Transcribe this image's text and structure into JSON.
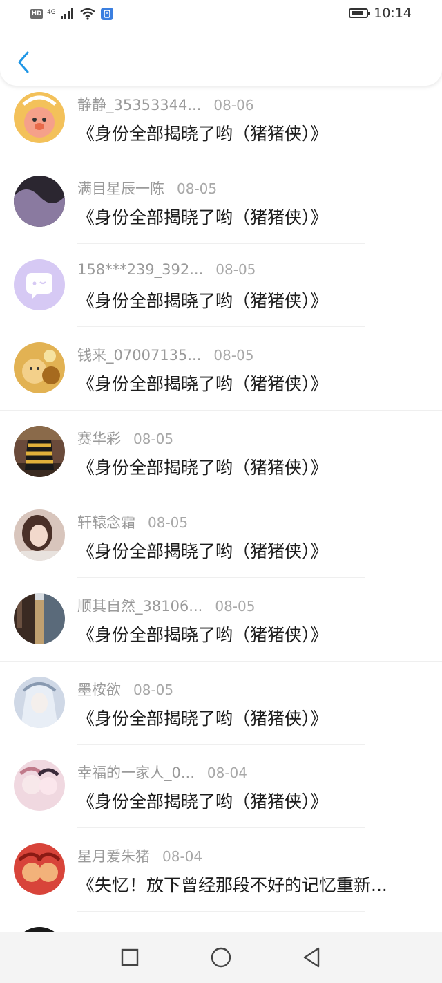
{
  "status_bar": {
    "hd": "HD",
    "network": "4G",
    "time": "10:14",
    "battery_level": 0.85
  },
  "header": {
    "back_icon": "chevron-left-icon",
    "accent_color": "#1e96e6"
  },
  "items": [
    {
      "username": "静静_35353344...",
      "date": "08-06",
      "title": "《身份全部揭晓了哟（猪猪侠）》",
      "avatar": {
        "kind": "cartoon",
        "bg": "#f3c15a",
        "fg": "#e86a4a"
      }
    },
    {
      "username": "满目星辰一陈",
      "date": "08-05",
      "title": "《身份全部揭晓了哟（猪猪侠）》",
      "avatar": {
        "kind": "dark",
        "bg": "#2b2630",
        "fg": "#8a7aa0"
      }
    },
    {
      "username": "158***239_392...",
      "date": "08-05",
      "title": "《身份全部揭晓了哟（猪猪侠）》",
      "avatar": {
        "kind": "default",
        "bg": "#d6c9f4",
        "fg": "#ffffff"
      }
    },
    {
      "username": "钱来_07007135...",
      "date": "08-05",
      "title": "《身份全部揭晓了哟（猪猪侠）》",
      "avatar": {
        "kind": "gold",
        "bg": "#e2b253",
        "fg": "#a66a1e"
      }
    },
    {
      "username": "赛华彩",
      "date": "08-05",
      "title": "《身份全部揭晓了哟（猪猪侠）》",
      "avatar": {
        "kind": "scene",
        "bg": "#6a4a3a",
        "fg": "#e0b03a"
      }
    },
    {
      "username": "轩辕念霜",
      "date": "08-05",
      "title": "《身份全部揭晓了哟（猪猪侠）》",
      "avatar": {
        "kind": "portrait",
        "bg": "#d8c5bc",
        "fg": "#4a3028"
      }
    },
    {
      "username": "顺其自然_38106...",
      "date": "08-05",
      "title": "《身份全部揭晓了哟（猪猪侠）》",
      "avatar": {
        "kind": "hall",
        "bg": "#3a2a22",
        "fg": "#c0a070"
      }
    },
    {
      "username": "墨桉欲",
      "date": "08-05",
      "title": "《身份全部揭晓了哟（猪猪侠）》",
      "avatar": {
        "kind": "anime",
        "bg": "#cfd8e6",
        "fg": "#8899b0"
      }
    },
    {
      "username": "幸福的一家人_0...",
      "date": "08-04",
      "title": "《身份全部揭晓了哟（猪猪侠）》",
      "avatar": {
        "kind": "anime-pink",
        "bg": "#f0d8e0",
        "fg": "#c07a8a"
      }
    },
    {
      "username": "星月爱朱猪",
      "date": "08-04",
      "title": "《失忆！放下曾经那段不好的记忆重新...",
      "avatar": {
        "kind": "red",
        "bg": "#d8443a",
        "fg": "#f2b27a"
      }
    }
  ],
  "partial_item": {
    "avatar": {
      "kind": "dark",
      "bg": "#1a1a1a",
      "fg": "#444444"
    }
  },
  "navbar": {
    "recent_icon": "square-icon",
    "home_icon": "circle-icon",
    "back_icon": "triangle-back-icon"
  }
}
